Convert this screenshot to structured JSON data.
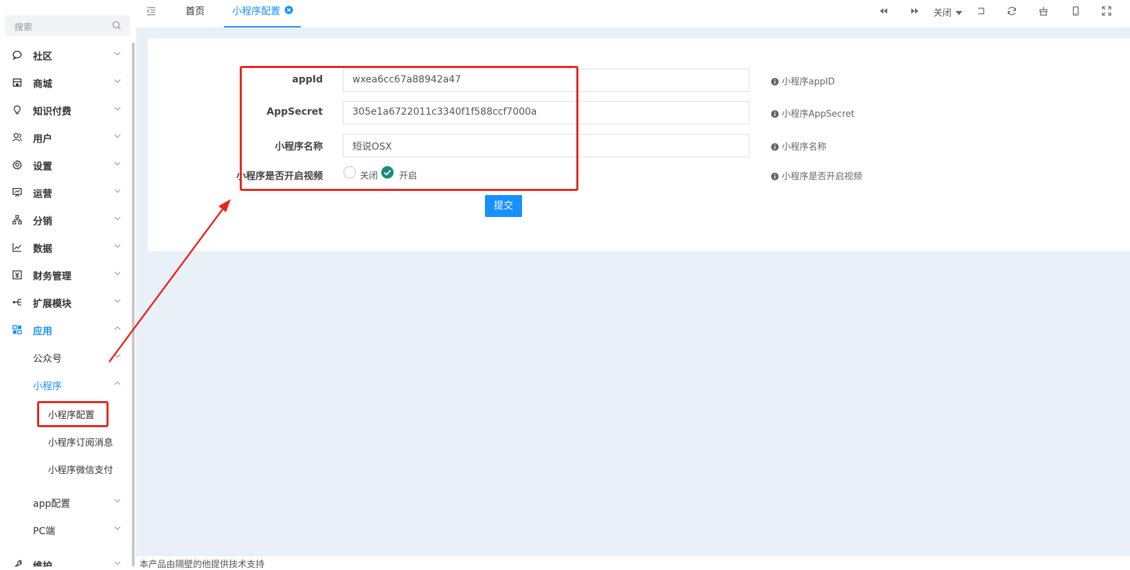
{
  "sidebar": {
    "search_placeholder": "搜索",
    "menu": [
      {
        "label": "社区",
        "icon": "chat-icon"
      },
      {
        "label": "商城",
        "icon": "store-icon"
      },
      {
        "label": "知识付费",
        "icon": "lightbulb-icon"
      },
      {
        "label": "用户",
        "icon": "users-icon"
      },
      {
        "label": "设置",
        "icon": "gear-icon"
      },
      {
        "label": "运营",
        "icon": "presentation-icon"
      },
      {
        "label": "分销",
        "icon": "hierarchy-icon"
      },
      {
        "label": "数据",
        "icon": "line-chart-icon"
      },
      {
        "label": "财务管理",
        "icon": "finance-icon"
      },
      {
        "label": "扩展模块",
        "icon": "extension-icon"
      },
      {
        "label": "应用",
        "icon": "apps-icon"
      }
    ],
    "app_children": [
      {
        "label": "公众号"
      },
      {
        "label": "小程序"
      }
    ],
    "mini_children": [
      {
        "label": "小程序配置"
      },
      {
        "label": "小程序订阅消息"
      },
      {
        "label": "小程序微信支付"
      }
    ],
    "more_children": [
      {
        "label": "app配置"
      },
      {
        "label": "PC端"
      }
    ],
    "last_item": {
      "label": "维护",
      "icon": "wrench-icon"
    }
  },
  "topbar": {
    "tabs": [
      {
        "label": "首页"
      },
      {
        "label": "小程序配置"
      }
    ],
    "close_label": "关闭"
  },
  "form": {
    "fields": [
      {
        "label": "appId",
        "value": "wxea6cc67a88942a47",
        "tip": "小程序appID"
      },
      {
        "label": "AppSecret",
        "value": "305e1a6722011c3340f1f588ccf7000a",
        "tip": "小程序AppSecret"
      },
      {
        "label": "小程序名称",
        "value": "短说OSX",
        "tip": "小程序名称"
      }
    ],
    "video": {
      "label": "小程序是否开启视频",
      "options": [
        "关闭",
        "开启"
      ],
      "selected": "开启",
      "tip": "小程序是否开启视频"
    },
    "submit_label": "提交"
  },
  "footer_text": "本产品由隔壁的他提供技术支持",
  "colors": {
    "accent": "#1890ff",
    "annotation": "#e8261c",
    "radio_checked": "#1a8a7a",
    "main_bg": "#e9f0f8"
  }
}
